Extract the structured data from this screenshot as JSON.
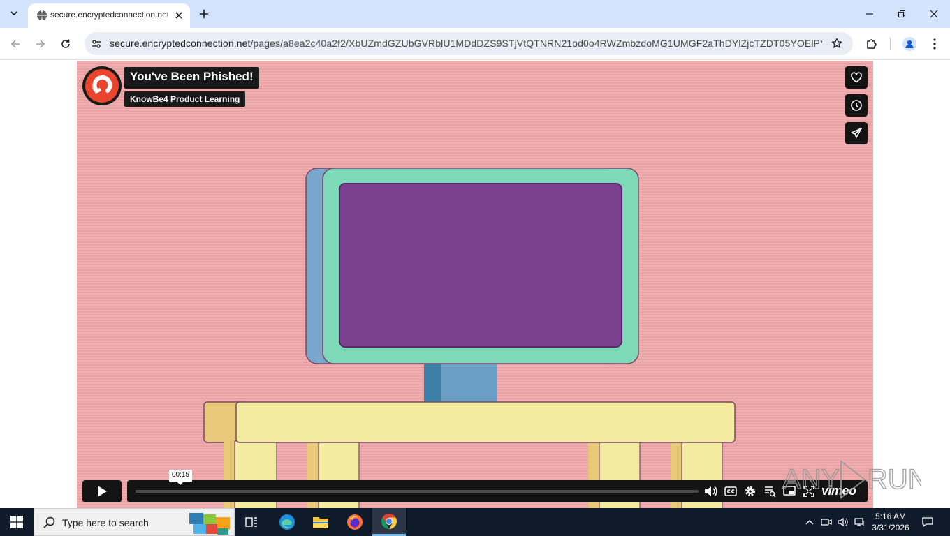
{
  "browser": {
    "tab": {
      "title": "secure.encryptedconnection.net"
    },
    "address_bar": {
      "domain": "secure.encryptedconnection.net",
      "path": "/pages/a8ea2c40a2f2/XbUZmdGZUbGVRblU1MDdDZS9STjVtQTNRN21od0o4RWZmbzdoMG1UMGF2aThDYlZjcTZDT05YOElPYVdlU..."
    }
  },
  "video": {
    "title": "You've Been Phished!",
    "byline": "KnowBe4 Product Learning",
    "current_time": "00:15",
    "progress": 0.0,
    "brand": "vimeo"
  },
  "watermark": {
    "text": "ANY RUN"
  },
  "taskbar": {
    "search_placeholder": "Type here to search",
    "clock": {
      "time": "5:16 AM",
      "date": "3/31/2026"
    }
  },
  "colors": {
    "tab_strip": "#d3e3fd",
    "video_background": "#eeadae",
    "monitor_frame": "#7ed9b8",
    "monitor_screen": "#7a3f8e",
    "table": "#f2eba0",
    "taskbar": "#0f1a2b"
  }
}
